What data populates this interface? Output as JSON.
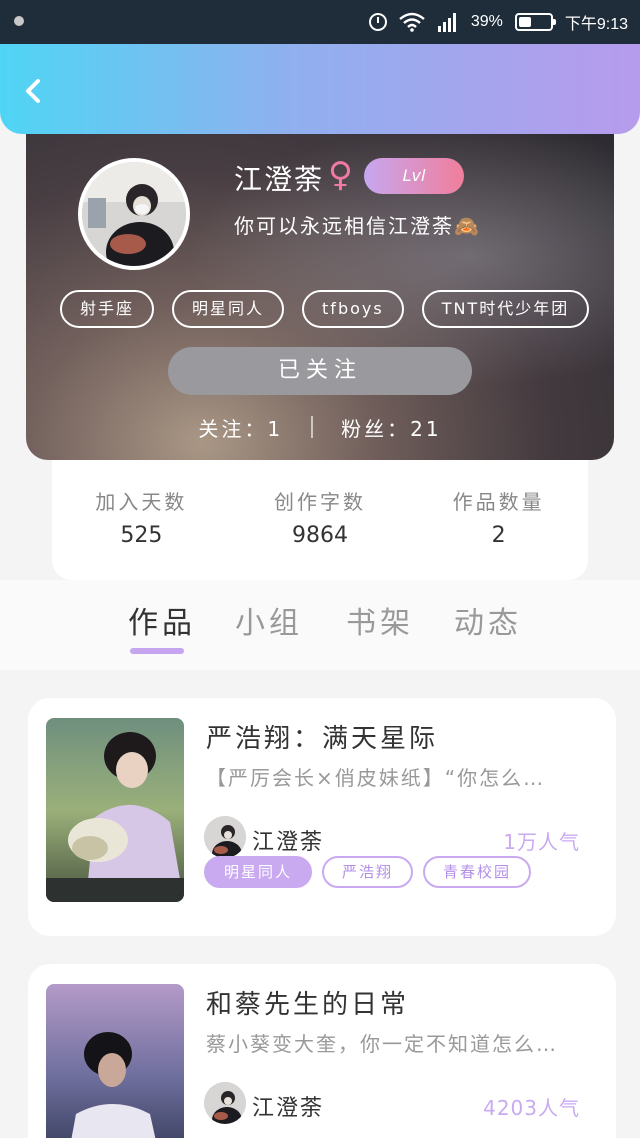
{
  "status_bar": {
    "battery_pct": "39%",
    "time": "下午9:13",
    "battery_level": 0.39
  },
  "header": {
    "back_icon": "chevron-left-icon"
  },
  "profile": {
    "name": "江澄荼",
    "gender_symbol": "♀",
    "level": "Lvl",
    "bio": "你可以永远相信江澄荼🙈",
    "tags": [
      "射手座",
      "明星同人",
      "tfboys",
      "TNT时代少年团"
    ],
    "follow_button": "已关注",
    "following_label": "关注：1",
    "fans_label": "粉丝：21"
  },
  "numbers": [
    {
      "label": "加入天数",
      "value": "525"
    },
    {
      "label": "创作字数",
      "value": "9864"
    },
    {
      "label": "作品数量",
      "value": "2"
    }
  ],
  "tabs": [
    {
      "label": "作品",
      "active": true
    },
    {
      "label": "小组",
      "active": false
    },
    {
      "label": "书架",
      "active": false
    },
    {
      "label": "动态",
      "active": false
    }
  ],
  "books": [
    {
      "title": "严浩翔：满天星际",
      "desc": "【严厉会长×俏皮妹纸】“你怎么…",
      "author": "江澄荼",
      "popularity": "1万人气",
      "tags": [
        "明星同人",
        "严浩翔",
        "青春校园"
      ]
    },
    {
      "title": "和蔡先生的日常",
      "desc": "蔡小葵变大奎，你一定不知道怎么…",
      "author": "江澄荼",
      "popularity": "4203人气"
    }
  ],
  "colors": {
    "accent": "#c9aaf0",
    "header_start": "#4fd5f5",
    "header_end": "#b79bec"
  }
}
